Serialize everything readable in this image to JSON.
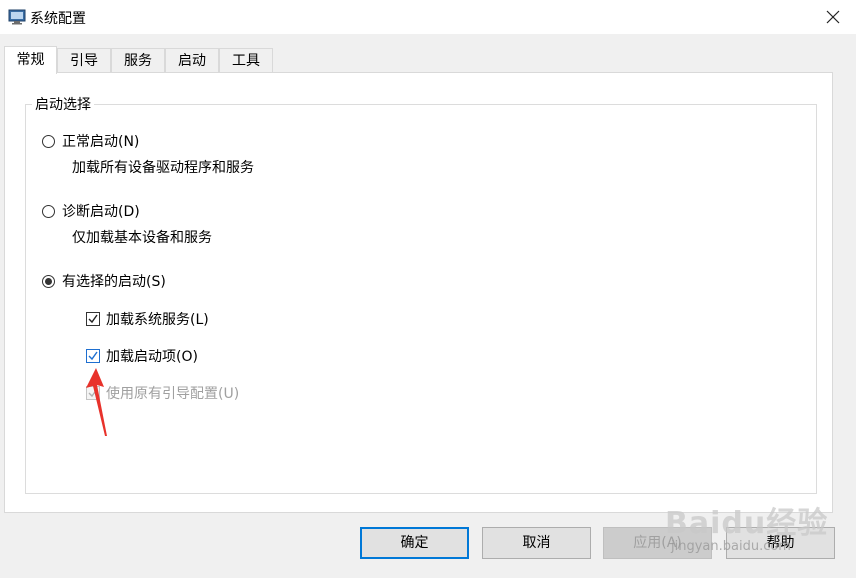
{
  "window": {
    "title": "系统配置"
  },
  "tabs": [
    {
      "label": "常规"
    },
    {
      "label": "引导"
    },
    {
      "label": "服务"
    },
    {
      "label": "启动"
    },
    {
      "label": "工具"
    }
  ],
  "startup_selection": {
    "group_label": "启动选择",
    "options": [
      {
        "label": "正常启动(N)",
        "description": "加载所有设备驱动程序和服务",
        "selected": false
      },
      {
        "label": "诊断启动(D)",
        "description": "仅加载基本设备和服务",
        "selected": false
      },
      {
        "label": "有选择的启动(S)",
        "selected": true
      }
    ],
    "checkboxes": [
      {
        "label": "加载系统服务(L)",
        "checked": true,
        "enabled": true
      },
      {
        "label": "加载启动项(O)",
        "checked": true,
        "enabled": true
      },
      {
        "label": "使用原有引导配置(U)",
        "checked": true,
        "enabled": false
      }
    ]
  },
  "buttons": {
    "ok": "确定",
    "cancel": "取消",
    "apply": "应用(A)",
    "help": "帮助"
  },
  "watermark": {
    "brand": "Baidu经验",
    "url": "jingyan.baidu.com"
  },
  "colors": {
    "accent": "#0078d7",
    "arrow": "#e8322b"
  }
}
